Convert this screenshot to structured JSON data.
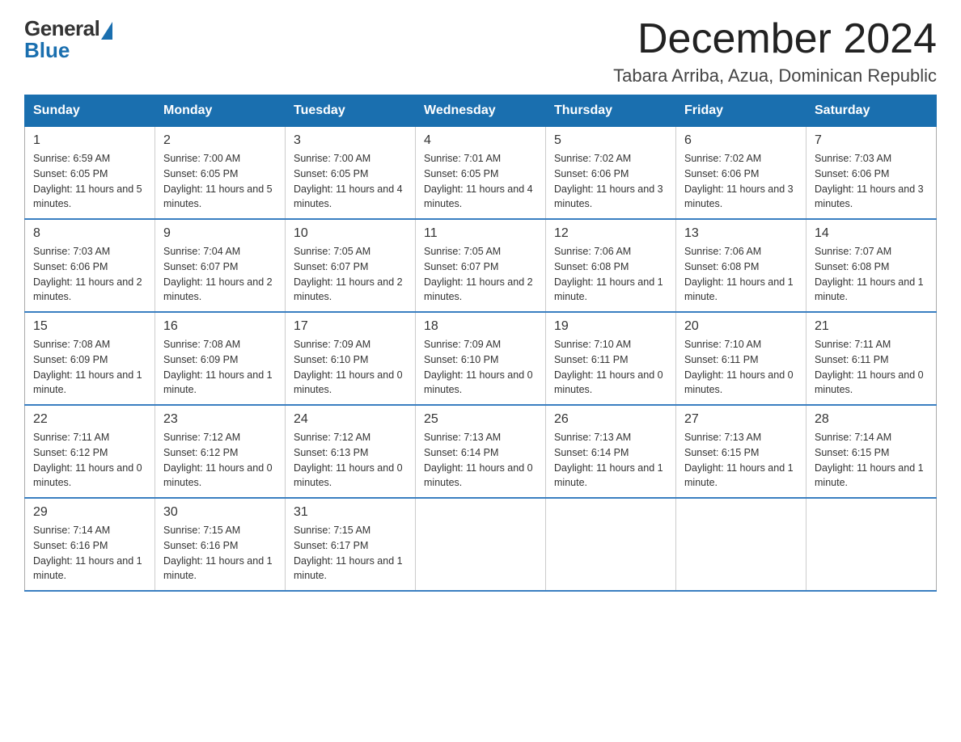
{
  "logo": {
    "general": "General",
    "blue": "Blue"
  },
  "title": {
    "month": "December 2024",
    "location": "Tabara Arriba, Azua, Dominican Republic"
  },
  "weekdays": [
    "Sunday",
    "Monday",
    "Tuesday",
    "Wednesday",
    "Thursday",
    "Friday",
    "Saturday"
  ],
  "weeks": [
    [
      {
        "day": "1",
        "sunrise": "6:59 AM",
        "sunset": "6:05 PM",
        "daylight": "11 hours and 5 minutes."
      },
      {
        "day": "2",
        "sunrise": "7:00 AM",
        "sunset": "6:05 PM",
        "daylight": "11 hours and 5 minutes."
      },
      {
        "day": "3",
        "sunrise": "7:00 AM",
        "sunset": "6:05 PM",
        "daylight": "11 hours and 4 minutes."
      },
      {
        "day": "4",
        "sunrise": "7:01 AM",
        "sunset": "6:05 PM",
        "daylight": "11 hours and 4 minutes."
      },
      {
        "day": "5",
        "sunrise": "7:02 AM",
        "sunset": "6:06 PM",
        "daylight": "11 hours and 3 minutes."
      },
      {
        "day": "6",
        "sunrise": "7:02 AM",
        "sunset": "6:06 PM",
        "daylight": "11 hours and 3 minutes."
      },
      {
        "day": "7",
        "sunrise": "7:03 AM",
        "sunset": "6:06 PM",
        "daylight": "11 hours and 3 minutes."
      }
    ],
    [
      {
        "day": "8",
        "sunrise": "7:03 AM",
        "sunset": "6:06 PM",
        "daylight": "11 hours and 2 minutes."
      },
      {
        "day": "9",
        "sunrise": "7:04 AM",
        "sunset": "6:07 PM",
        "daylight": "11 hours and 2 minutes."
      },
      {
        "day": "10",
        "sunrise": "7:05 AM",
        "sunset": "6:07 PM",
        "daylight": "11 hours and 2 minutes."
      },
      {
        "day": "11",
        "sunrise": "7:05 AM",
        "sunset": "6:07 PM",
        "daylight": "11 hours and 2 minutes."
      },
      {
        "day": "12",
        "sunrise": "7:06 AM",
        "sunset": "6:08 PM",
        "daylight": "11 hours and 1 minute."
      },
      {
        "day": "13",
        "sunrise": "7:06 AM",
        "sunset": "6:08 PM",
        "daylight": "11 hours and 1 minute."
      },
      {
        "day": "14",
        "sunrise": "7:07 AM",
        "sunset": "6:08 PM",
        "daylight": "11 hours and 1 minute."
      }
    ],
    [
      {
        "day": "15",
        "sunrise": "7:08 AM",
        "sunset": "6:09 PM",
        "daylight": "11 hours and 1 minute."
      },
      {
        "day": "16",
        "sunrise": "7:08 AM",
        "sunset": "6:09 PM",
        "daylight": "11 hours and 1 minute."
      },
      {
        "day": "17",
        "sunrise": "7:09 AM",
        "sunset": "6:10 PM",
        "daylight": "11 hours and 0 minutes."
      },
      {
        "day": "18",
        "sunrise": "7:09 AM",
        "sunset": "6:10 PM",
        "daylight": "11 hours and 0 minutes."
      },
      {
        "day": "19",
        "sunrise": "7:10 AM",
        "sunset": "6:11 PM",
        "daylight": "11 hours and 0 minutes."
      },
      {
        "day": "20",
        "sunrise": "7:10 AM",
        "sunset": "6:11 PM",
        "daylight": "11 hours and 0 minutes."
      },
      {
        "day": "21",
        "sunrise": "7:11 AM",
        "sunset": "6:11 PM",
        "daylight": "11 hours and 0 minutes."
      }
    ],
    [
      {
        "day": "22",
        "sunrise": "7:11 AM",
        "sunset": "6:12 PM",
        "daylight": "11 hours and 0 minutes."
      },
      {
        "day": "23",
        "sunrise": "7:12 AM",
        "sunset": "6:12 PM",
        "daylight": "11 hours and 0 minutes."
      },
      {
        "day": "24",
        "sunrise": "7:12 AM",
        "sunset": "6:13 PM",
        "daylight": "11 hours and 0 minutes."
      },
      {
        "day": "25",
        "sunrise": "7:13 AM",
        "sunset": "6:14 PM",
        "daylight": "11 hours and 0 minutes."
      },
      {
        "day": "26",
        "sunrise": "7:13 AM",
        "sunset": "6:14 PM",
        "daylight": "11 hours and 1 minute."
      },
      {
        "day": "27",
        "sunrise": "7:13 AM",
        "sunset": "6:15 PM",
        "daylight": "11 hours and 1 minute."
      },
      {
        "day": "28",
        "sunrise": "7:14 AM",
        "sunset": "6:15 PM",
        "daylight": "11 hours and 1 minute."
      }
    ],
    [
      {
        "day": "29",
        "sunrise": "7:14 AM",
        "sunset": "6:16 PM",
        "daylight": "11 hours and 1 minute."
      },
      {
        "day": "30",
        "sunrise": "7:15 AM",
        "sunset": "6:16 PM",
        "daylight": "11 hours and 1 minute."
      },
      {
        "day": "31",
        "sunrise": "7:15 AM",
        "sunset": "6:17 PM",
        "daylight": "11 hours and 1 minute."
      },
      null,
      null,
      null,
      null
    ]
  ],
  "colors": {
    "header_bg": "#1a6faf",
    "header_text": "#ffffff",
    "border": "#3a7fc1"
  }
}
